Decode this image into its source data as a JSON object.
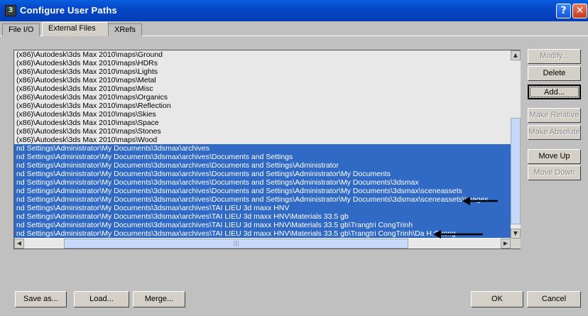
{
  "window": {
    "title": "Configure User Paths"
  },
  "tabs": [
    {
      "label": "File I/O",
      "active": false
    },
    {
      "label": "External Files",
      "active": true
    },
    {
      "label": "XRefs",
      "active": false
    }
  ],
  "paths": [
    "(x86)\\Autodesk\\3ds Max 2010\\maps\\Ground",
    "(x86)\\Autodesk\\3ds Max 2010\\maps\\HDRs",
    "(x86)\\Autodesk\\3ds Max 2010\\maps\\Lights",
    "(x86)\\Autodesk\\3ds Max 2010\\maps\\Metal",
    "(x86)\\Autodesk\\3ds Max 2010\\maps\\Misc",
    "(x86)\\Autodesk\\3ds Max 2010\\maps\\Organics",
    "(x86)\\Autodesk\\3ds Max 2010\\maps\\Reflection",
    "(x86)\\Autodesk\\3ds Max 2010\\maps\\Skies",
    "(x86)\\Autodesk\\3ds Max 2010\\maps\\Space",
    "(x86)\\Autodesk\\3ds Max 2010\\maps\\Stones",
    "(x86)\\Autodesk\\3ds Max 2010\\maps\\Wood",
    "nd Settings\\Administrator\\My Documents\\3dsmax\\archives",
    "nd Settings\\Administrator\\My Documents\\3dsmax\\archives\\Documents and Settings",
    "nd Settings\\Administrator\\My Documents\\3dsmax\\archives\\Documents and Settings\\Administrator",
    "nd Settings\\Administrator\\My Documents\\3dsmax\\archives\\Documents and Settings\\Administrator\\My Documents",
    "nd Settings\\Administrator\\My Documents\\3dsmax\\archives\\Documents and Settings\\Administrator\\My Documents\\3dsmax",
    "nd Settings\\Administrator\\My Documents\\3dsmax\\archives\\Documents and Settings\\Administrator\\My Documents\\3dsmax\\sceneassets",
    "nd Settings\\Administrator\\My Documents\\3dsmax\\archives\\Documents and Settings\\Administrator\\My Documents\\3dsmax\\sceneassets\\images",
    "nd Settings\\Administrator\\My Documents\\3dsmax\\archives\\TAI LIEU 3d maxx HNV",
    "nd Settings\\Administrator\\My Documents\\3dsmax\\archives\\TAI LIEU 3d maxx HNV\\Materials 33.5 gb",
    "nd Settings\\Administrator\\My Documents\\3dsmax\\archives\\TAI LIEU 3d maxx HNV\\Materials 33.5 gb\\Trangtri CongTrinh",
    "nd Settings\\Administrator\\My Documents\\3dsmax\\archives\\TAI LIEU 3d maxx HNV\\Materials 33.5 gb\\Trangtri CongTrinh\\Da H.Cuong"
  ],
  "selected_from": 11,
  "side_buttons": [
    {
      "label": "Modify...",
      "enabled": false
    },
    {
      "label": "Delete",
      "enabled": true
    },
    {
      "label": "Add...",
      "enabled": true,
      "focused": true
    },
    {
      "label": "Make Relative",
      "enabled": false
    },
    {
      "label": "Make Absolute",
      "enabled": false
    },
    {
      "label": "Move Up",
      "enabled": true
    },
    {
      "label": "Move Down",
      "enabled": false
    }
  ],
  "bottom_buttons": {
    "save_as": "Save as...",
    "load": "Load...",
    "merge": "Merge...",
    "ok": "OK",
    "cancel": "Cancel"
  },
  "icons": {
    "app": "3ds-max-icon",
    "help": "help-icon",
    "close": "close-icon",
    "annotation": "arrow-left-icon"
  },
  "colors": {
    "selection": "#316ac5",
    "titlebar": "#0547c7"
  }
}
